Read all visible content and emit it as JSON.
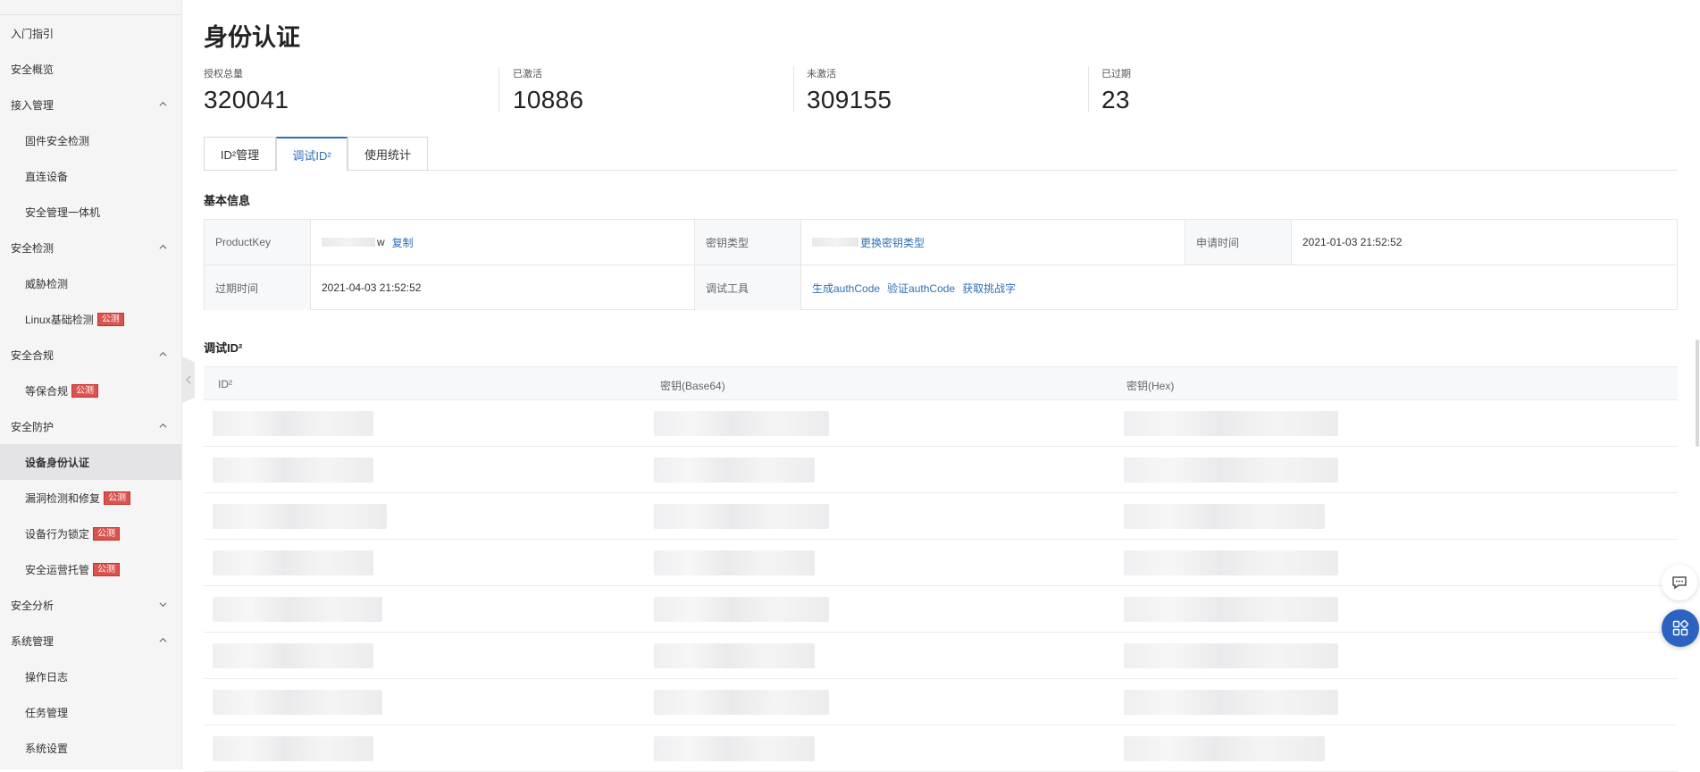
{
  "sidebar": {
    "items": [
      {
        "label": "入门指引",
        "level": 1,
        "chevron": "none",
        "badge": ""
      },
      {
        "label": "安全概览",
        "level": 1,
        "chevron": "none",
        "badge": ""
      },
      {
        "label": "接入管理",
        "level": 1,
        "chevron": "up",
        "badge": ""
      },
      {
        "label": "固件安全检测",
        "level": 2,
        "chevron": "none",
        "badge": ""
      },
      {
        "label": "直连设备",
        "level": 2,
        "chevron": "none",
        "badge": ""
      },
      {
        "label": "安全管理一体机",
        "level": 2,
        "chevron": "none",
        "badge": ""
      },
      {
        "label": "安全检测",
        "level": 1,
        "chevron": "up",
        "badge": ""
      },
      {
        "label": "威胁检测",
        "level": 2,
        "chevron": "none",
        "badge": ""
      },
      {
        "label": "Linux基础检测",
        "level": 2,
        "chevron": "none",
        "badge": "公测"
      },
      {
        "label": "安全合规",
        "level": 1,
        "chevron": "up",
        "badge": ""
      },
      {
        "label": "等保合规",
        "level": 2,
        "chevron": "none",
        "badge": "公测"
      },
      {
        "label": "安全防护",
        "level": 1,
        "chevron": "up",
        "badge": ""
      },
      {
        "label": "设备身份认证",
        "level": 2,
        "chevron": "none",
        "badge": "",
        "active": true
      },
      {
        "label": "漏洞检测和修复",
        "level": 2,
        "chevron": "none",
        "badge": "公测"
      },
      {
        "label": "设备行为锁定",
        "level": 2,
        "chevron": "none",
        "badge": "公测"
      },
      {
        "label": "安全运营托管",
        "level": 2,
        "chevron": "none",
        "badge": "公测"
      },
      {
        "label": "安全分析",
        "level": 1,
        "chevron": "down",
        "badge": ""
      },
      {
        "label": "系统管理",
        "level": 1,
        "chevron": "up",
        "badge": ""
      },
      {
        "label": "操作日志",
        "level": 2,
        "chevron": "none",
        "badge": ""
      },
      {
        "label": "任务管理",
        "level": 2,
        "chevron": "none",
        "badge": ""
      },
      {
        "label": "系统设置",
        "level": 2,
        "chevron": "none",
        "badge": ""
      }
    ]
  },
  "page": {
    "title": "身份认证"
  },
  "stats": [
    {
      "label": "授权总量",
      "value": "320041"
    },
    {
      "label": "已激活",
      "value": "10886"
    },
    {
      "label": "未激活",
      "value": "309155"
    },
    {
      "label": "已过期",
      "value": "23"
    }
  ],
  "tabs": [
    {
      "label": "ID²管理",
      "active": false
    },
    {
      "label": "调试ID²",
      "active": true
    },
    {
      "label": "使用统计",
      "active": false
    }
  ],
  "basic_info": {
    "title": "基本信息",
    "product_key_label": "ProductKey",
    "product_key_suffix": "w",
    "copy_link": "复制",
    "key_type_label": "密钥类型",
    "change_key_type_link": "更换密钥类型",
    "apply_time_label": "申请时间",
    "apply_time": "2021-01-03 21:52:52",
    "expire_time_label": "过期时间",
    "expire_time": "2021-04-03 21:52:52",
    "debug_tools_label": "调试工具",
    "tools": [
      "生成authCode",
      "验证authCode",
      "获取挑战字"
    ]
  },
  "debug_table": {
    "title": "调试ID²",
    "columns": [
      "ID²",
      "密钥(Base64)",
      "密钥(Hex)"
    ],
    "row_count": 8
  },
  "colors": {
    "accent": "#2f6fb6",
    "badge": "#d9534f",
    "fab": "#2c63c2"
  }
}
